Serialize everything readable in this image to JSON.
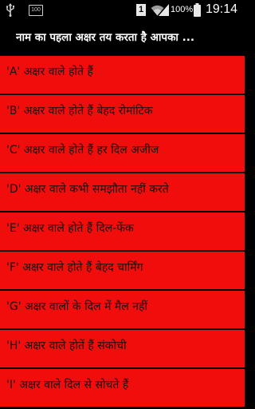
{
  "status_bar": {
    "usb_icon": "usb-icon",
    "image_icon_label": "100",
    "sim_label": "1",
    "wifi_icon": "wifi-icon",
    "signal_icon": "signal-icon",
    "battery_percent": "100%",
    "battery_icon": "battery-icon",
    "time": "19:14"
  },
  "header": {
    "title": "नाम का पहला अक्षर तय करता है आपका ..."
  },
  "colors": {
    "item_background": "#f20d0d",
    "header_background": "#000000",
    "text": "#111111"
  },
  "list": {
    "items": [
      {
        "label": "'A' अक्षर वाले होते हैं"
      },
      {
        "label": "'B' अक्षर वाले होते हैं बेहद रोमांटिक"
      },
      {
        "label": "'C' अक्षर वाले होते हैं हर दिल अजीज"
      },
      {
        "label": "'D' अक्षर वाले कभी समझौता नहीं करते"
      },
      {
        "label": "'E' अक्षर वाले होते हैं दिल-फेंक"
      },
      {
        "label": "'F' अक्षर वाले होते हैं बेहद चार्मिंग"
      },
      {
        "label": "'G' अक्षर वालों के दिल में मैल नहीं"
      },
      {
        "label": "'H' अक्षर वाले होतें हैं संकोची"
      },
      {
        "label": "'I' अक्षर वाले दिल से सोचते हैं"
      }
    ]
  }
}
